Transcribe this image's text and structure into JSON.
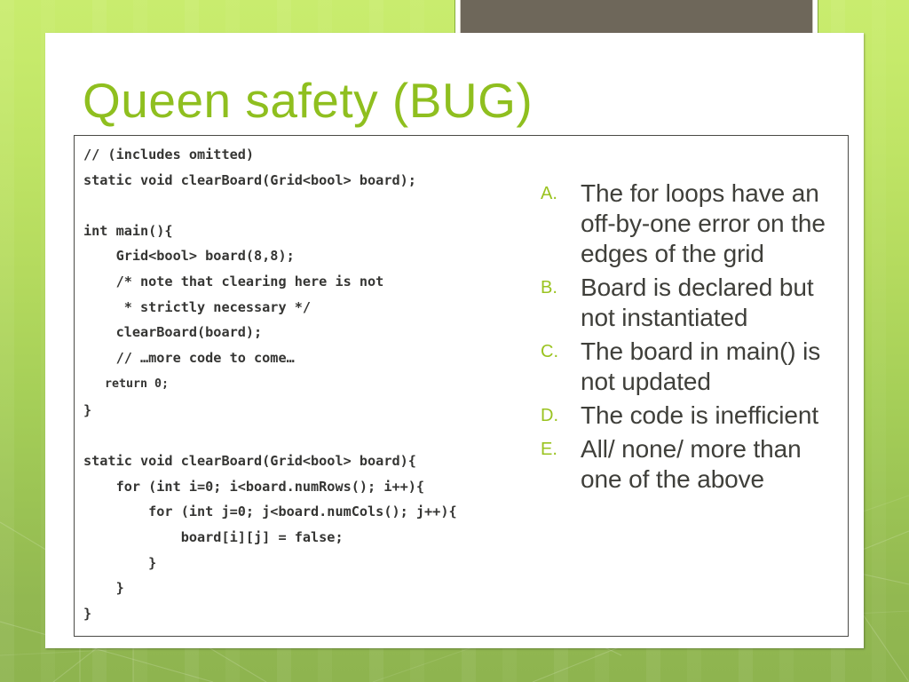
{
  "slide": {
    "title": "Queen safety (BUG)",
    "title_color": "#8fbf1f",
    "body_text_color": "#3f3f3a",
    "accent_block_color": "#6e675a",
    "background_top_color": "#c9ec6e",
    "background_bottom_color": "#8eb44f"
  },
  "code": {
    "language": "cpp",
    "lines": [
      "// (includes omitted)",
      "static void clearBoard(Grid<bool> board);",
      "",
      "int main(){",
      "    Grid<bool> board(8,8);",
      "    /* note that clearing here is not",
      "     * strictly necessary */",
      "    clearBoard(board);",
      "    // …more code to come…",
      "   return 0;",
      "}",
      "",
      "static void clearBoard(Grid<bool> board){",
      "    for (int i=0; i<board.numRows(); i++){",
      "        for (int j=0; j<board.numCols(); j++){",
      "            board[i][j] = false;",
      "        }",
      "    }",
      "}"
    ],
    "line_1": "// (includes omitted)",
    "line_2": "static void clearBoard(Grid<bool> board);",
    "line_3": "",
    "line_4": "int main(){",
    "line_5": "    Grid<bool> board(8,8);",
    "line_6": "    /* note that clearing here is not",
    "line_7": "     * strictly necessary */",
    "line_8": "    clearBoard(board);",
    "line_9": "    // …more code to come…",
    "line_10": "   return 0;",
    "line_11": "}",
    "line_12": "",
    "line_13": "static void clearBoard(Grid<bool> board){",
    "line_14": "    for (int i=0; i<board.numRows(); i++){",
    "line_15": "        for (int j=0; j<board.numCols(); j++){",
    "line_16": "            board[i][j] = false;",
    "line_17": "        }",
    "line_18": "    }",
    "line_19": "}"
  },
  "answers": [
    {
      "marker": "A.",
      "text": "The for loops have an off-by-one error on the edges of the grid"
    },
    {
      "marker": "B.",
      "text": "Board is declared but not instantiated"
    },
    {
      "marker": "C.",
      "text": "The board in main() is not updated"
    },
    {
      "marker": "D.",
      "text": "The code is inefficient"
    },
    {
      "marker": "E.",
      "text": "All/ none/ more than one of the above"
    }
  ]
}
